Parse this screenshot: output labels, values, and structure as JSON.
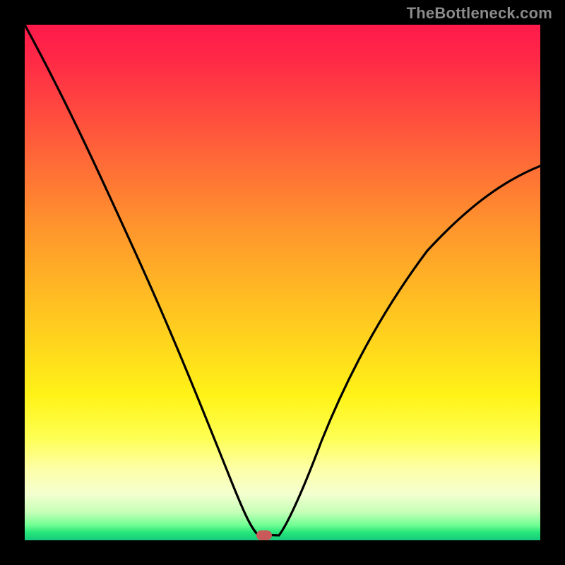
{
  "watermark_text": "TheBottleneck.com",
  "colors": {
    "frame": "#000000",
    "curve": "#000000",
    "marker": "#c85a5a",
    "watermark": "#8a8a8a",
    "gradient_stops": [
      "#ff1a4b",
      "#ff2747",
      "#ff4a3f",
      "#ff6f36",
      "#ff942d",
      "#ffb724",
      "#ffd91c",
      "#fff317",
      "#feff52",
      "#fdffa5",
      "#f4ffd0",
      "#c7ffb8",
      "#73ff94",
      "#26e67a",
      "#17c97c"
    ]
  },
  "chart_data": {
    "type": "line",
    "title": "",
    "xlabel": "",
    "ylabel": "",
    "xlim": [
      0,
      100
    ],
    "ylim": [
      0,
      100
    ],
    "series": [
      {
        "name": "bottleneck-curve",
        "x": [
          0,
          6,
          12,
          18,
          24,
          30,
          36,
          40,
          44,
          46,
          48,
          50,
          54,
          58,
          64,
          72,
          80,
          88,
          96,
          100
        ],
        "y": [
          100,
          88,
          76,
          64,
          52,
          40,
          27,
          16,
          6,
          1.5,
          0.5,
          0.5,
          6,
          14,
          27,
          42,
          53,
          62,
          69,
          72
        ]
      }
    ],
    "marker": {
      "x": 46.5,
      "y": 0.6
    },
    "notes": "V-shaped bottleneck curve over a vertical rainbow-style gradient; values are visual estimates (no axis ticks or labels are present in the source image)."
  }
}
